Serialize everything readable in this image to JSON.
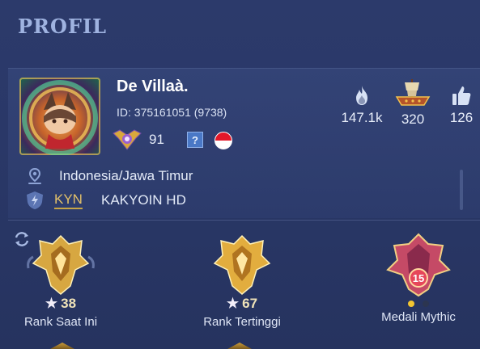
{
  "header": {
    "title": "PROFIL"
  },
  "profile": {
    "name": "De Villaà.",
    "id_text": "ID: 375161051 (9738)",
    "level": "91",
    "help_badge": "?",
    "stats": {
      "popularity": "147.1k",
      "favorites": "320",
      "likes": "126"
    },
    "location": "Indonesia/Jawa Timur",
    "squad": {
      "tag": "KYN",
      "name": "KAKYOIN HD"
    }
  },
  "medals": [
    {
      "stars": "38",
      "label": "Rank Saat Ini"
    },
    {
      "stars": "67",
      "label": "Rank Tertinggi"
    },
    {
      "badge_number": "15",
      "label": "Medali Mythic"
    }
  ],
  "colors": {
    "background": "#2a3868",
    "gold": "#e2c06a",
    "flag_red": "#e3182a",
    "dot_active": "#f3c531",
    "dot_inactive": "#2c3550"
  },
  "icons": {
    "location": "map-pin-icon",
    "squad": "shield-bolt-icon",
    "popularity": "flame-icon",
    "favorites": "ship-icon",
    "likes": "thumbs-up-icon",
    "refresh": "refresh-icon"
  }
}
